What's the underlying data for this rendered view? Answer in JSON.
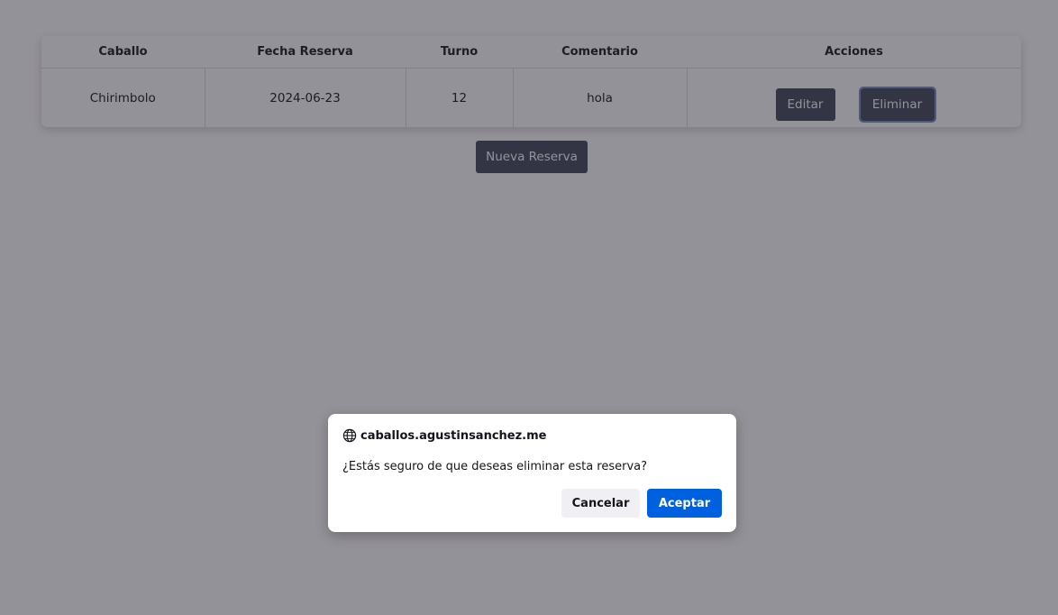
{
  "table": {
    "headers": [
      "Caballo",
      "Fecha Reserva",
      "Turno",
      "Comentario",
      "Acciones"
    ],
    "rows": [
      {
        "caballo": "Chirimbolo",
        "fecha": "2024-06-23",
        "turno": "12",
        "comentario": "hola",
        "edit_label": "Editar",
        "delete_label": "Eliminar"
      }
    ]
  },
  "new_reservation_label": "Nueva Reserva",
  "dialog": {
    "origin": "caballos.agustinsanchez.me",
    "origin_icon": "globe-icon",
    "message": "¿Estás seguro de que deseas eliminar esta reserva?",
    "cancel_label": "Cancelar",
    "accept_label": "Aceptar"
  },
  "colors": {
    "button_dark": "#4a5063",
    "accept_blue": "#0061e0",
    "overlay": "rgba(26,24,36,0.47)"
  }
}
